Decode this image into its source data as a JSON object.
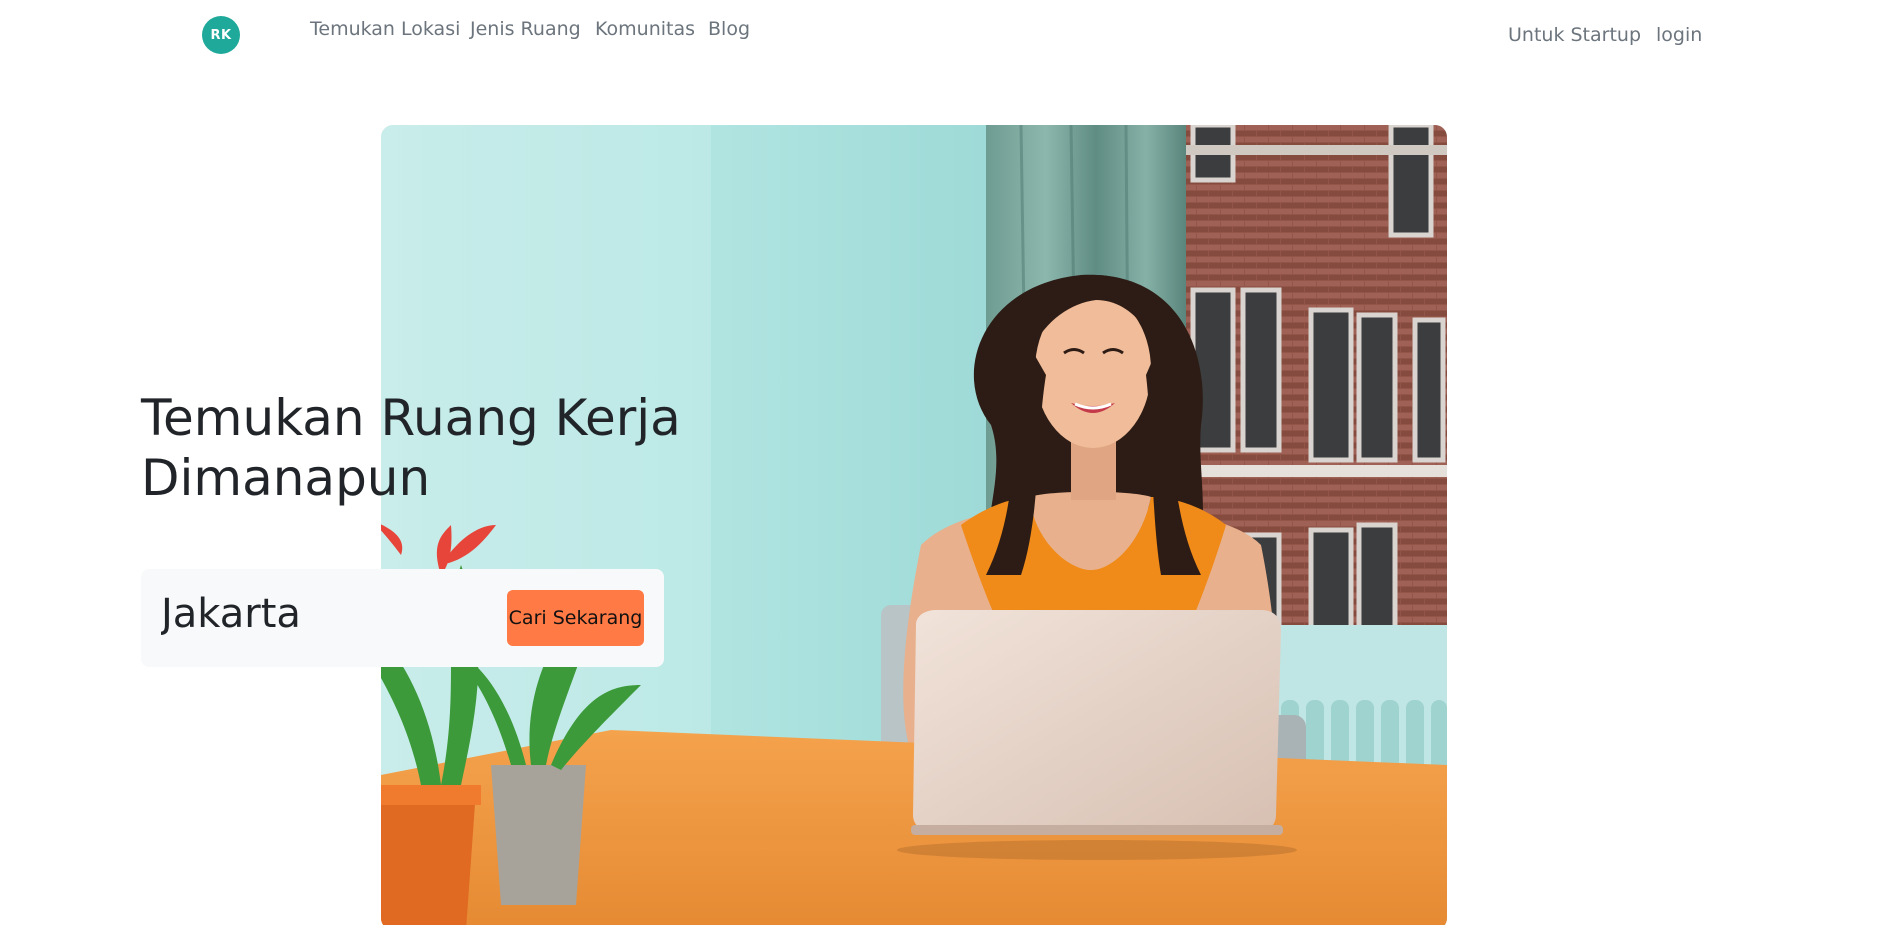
{
  "brand": {
    "logo_text": "RK",
    "logo_color": "#1fa99a"
  },
  "nav": {
    "left_links": [
      {
        "label": "Temukan Lokasi"
      },
      {
        "label": "Jenis Ruang"
      },
      {
        "label": "Komunitas"
      },
      {
        "label": "Blog"
      }
    ],
    "right_links": [
      {
        "label": "Untuk Startup"
      },
      {
        "label": "login"
      }
    ]
  },
  "hero": {
    "title": "Temukan Ruang Kerja Dimanapun",
    "image_subject": "woman-working-on-laptop"
  },
  "search": {
    "value": "Jakarta",
    "button_label": "Cari Sekarang",
    "button_color": "#ff7a45"
  }
}
